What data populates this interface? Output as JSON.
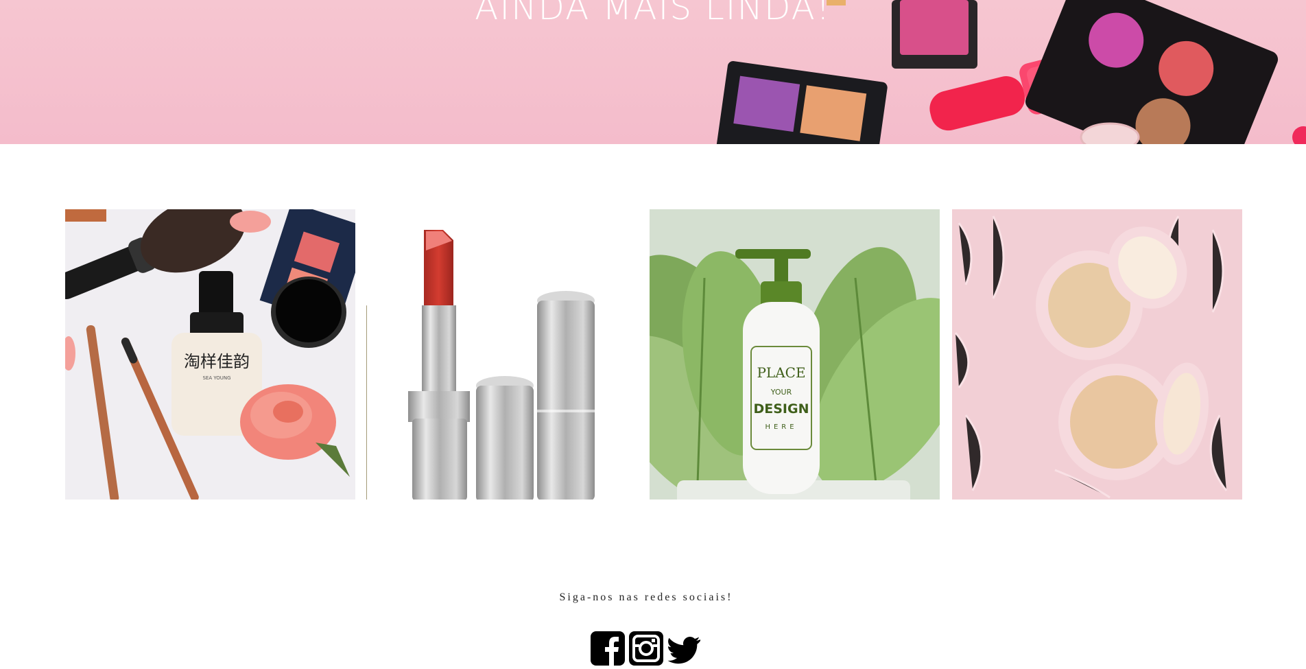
{
  "hero": {
    "title": "AINDA MAIS LINDA!"
  },
  "gallery": {
    "items": [
      {
        "name": "foundation-product-photo",
        "product_label": "淘样佳韵",
        "product_sublabel": "SEA YOUNG"
      },
      {
        "name": "lipstick-product-photo"
      },
      {
        "name": "pump-bottle-product-photo",
        "bottle_text_1": "PLACE",
        "bottle_text_2": "YOUR",
        "bottle_text_3": "DESIGN",
        "bottle_text_4": "HERE"
      },
      {
        "name": "compact-powder-product-photo"
      }
    ]
  },
  "social": {
    "title": "Siga-nos nas redes sociais!",
    "links": [
      {
        "icon": "facebook-icon"
      },
      {
        "icon": "instagram-icon"
      },
      {
        "icon": "twitter-icon"
      }
    ]
  },
  "colors": {
    "hero_pink": "#f6c6d1",
    "icon_black": "#000000"
  }
}
